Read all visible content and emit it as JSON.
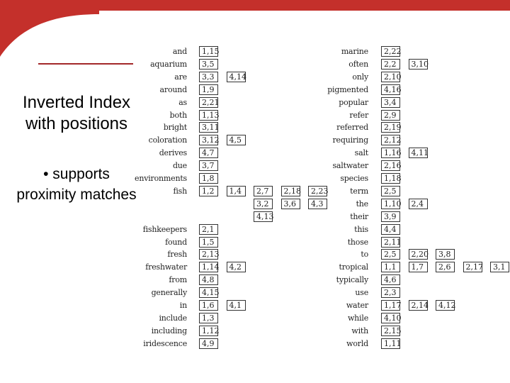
{
  "slide": {
    "title_line1": "Inverted Index",
    "title_line2": "with positions",
    "bullet_line1": "• supports",
    "bullet_line2": "proximity matches",
    "accent_color": "#c4302b"
  },
  "index": {
    "left": [
      {
        "term": "and",
        "postings": [
          [
            "1,15"
          ]
        ]
      },
      {
        "term": "aquarium",
        "postings": [
          [
            "3,5"
          ]
        ]
      },
      {
        "term": "are",
        "postings": [
          [
            "3,3"
          ],
          [
            "4,14"
          ]
        ]
      },
      {
        "term": "around",
        "postings": [
          [
            "1,9"
          ]
        ]
      },
      {
        "term": "as",
        "postings": [
          [
            "2,21"
          ]
        ]
      },
      {
        "term": "both",
        "postings": [
          [
            "1,13"
          ]
        ]
      },
      {
        "term": "bright",
        "postings": [
          [
            "3,11"
          ]
        ]
      },
      {
        "term": "coloration",
        "postings": [
          [
            "3,12"
          ],
          [
            "4,5"
          ]
        ]
      },
      {
        "term": "derives",
        "postings": [
          [
            "4,7"
          ]
        ]
      },
      {
        "term": "due",
        "postings": [
          [
            "3,7"
          ]
        ]
      },
      {
        "term": "environments",
        "postings": [
          [
            "1,8"
          ]
        ]
      },
      {
        "term": "fish",
        "postings": [
          [
            "1,2"
          ],
          [
            "1,4"
          ],
          [
            "2,7",
            "3,2",
            "4,13"
          ],
          [
            "2,18",
            "3,6"
          ],
          [
            "2,23",
            "4,3"
          ]
        ]
      },
      {
        "term": "",
        "postings": []
      },
      {
        "term": "",
        "postings": []
      },
      {
        "term": "fishkeepers",
        "postings": [
          [
            "2,1"
          ]
        ]
      },
      {
        "term": "found",
        "postings": [
          [
            "1,5"
          ]
        ]
      },
      {
        "term": "fresh",
        "postings": [
          [
            "2,13"
          ]
        ]
      },
      {
        "term": "freshwater",
        "postings": [
          [
            "1,14"
          ],
          [
            "4,2"
          ]
        ]
      },
      {
        "term": "from",
        "postings": [
          [
            "4,8"
          ]
        ]
      },
      {
        "term": "generally",
        "postings": [
          [
            "4,15"
          ]
        ]
      },
      {
        "term": "in",
        "postings": [
          [
            "1,6"
          ],
          [
            "4,1"
          ]
        ]
      },
      {
        "term": "include",
        "postings": [
          [
            "1,3"
          ]
        ]
      },
      {
        "term": "including",
        "postings": [
          [
            "1,12"
          ]
        ]
      },
      {
        "term": "iridescence",
        "postings": [
          [
            "4,9"
          ]
        ]
      }
    ],
    "right": [
      {
        "term": "marine",
        "postings": [
          [
            "2,22"
          ]
        ]
      },
      {
        "term": "often",
        "postings": [
          [
            "2,2"
          ],
          [
            "3,10"
          ]
        ]
      },
      {
        "term": "only",
        "postings": [
          [
            "2,10"
          ]
        ]
      },
      {
        "term": "pigmented",
        "postings": [
          [
            "4,16"
          ]
        ]
      },
      {
        "term": "popular",
        "postings": [
          [
            "3,4"
          ]
        ]
      },
      {
        "term": "refer",
        "postings": [
          [
            "2,9"
          ]
        ]
      },
      {
        "term": "referred",
        "postings": [
          [
            "2,19"
          ]
        ]
      },
      {
        "term": "requiring",
        "postings": [
          [
            "2,12"
          ]
        ]
      },
      {
        "term": "salt",
        "postings": [
          [
            "1,16"
          ],
          [
            "4,11"
          ]
        ]
      },
      {
        "term": "saltwater",
        "postings": [
          [
            "2,16"
          ]
        ]
      },
      {
        "term": "species",
        "postings": [
          [
            "1,18"
          ]
        ]
      },
      {
        "term": "term",
        "postings": [
          [
            "2,5"
          ]
        ]
      },
      {
        "term": "the",
        "postings": [
          [
            "1,10"
          ],
          [
            "2,4"
          ]
        ]
      },
      {
        "term": "their",
        "postings": [
          [
            "3,9"
          ]
        ]
      },
      {
        "term": "this",
        "postings": [
          [
            "4,4"
          ]
        ]
      },
      {
        "term": "those",
        "postings": [
          [
            "2,11"
          ]
        ]
      },
      {
        "term": "to",
        "postings": [
          [
            "2,5"
          ],
          [
            "2,20"
          ],
          [
            "3,8"
          ]
        ]
      },
      {
        "term": "tropical",
        "postings": [
          [
            "1,1"
          ],
          [
            "1,7"
          ],
          [
            "2,6"
          ],
          [
            "2,17"
          ],
          [
            "3,1"
          ]
        ]
      },
      {
        "term": "typically",
        "postings": [
          [
            "4,6"
          ]
        ]
      },
      {
        "term": "use",
        "postings": [
          [
            "2,3"
          ]
        ]
      },
      {
        "term": "water",
        "postings": [
          [
            "1,17"
          ],
          [
            "2,14"
          ],
          [
            "4,12"
          ]
        ]
      },
      {
        "term": "while",
        "postings": [
          [
            "4,10"
          ]
        ]
      },
      {
        "term": "with",
        "postings": [
          [
            "2,15"
          ]
        ]
      },
      {
        "term": "world",
        "postings": [
          [
            "1,11"
          ]
        ]
      }
    ]
  }
}
